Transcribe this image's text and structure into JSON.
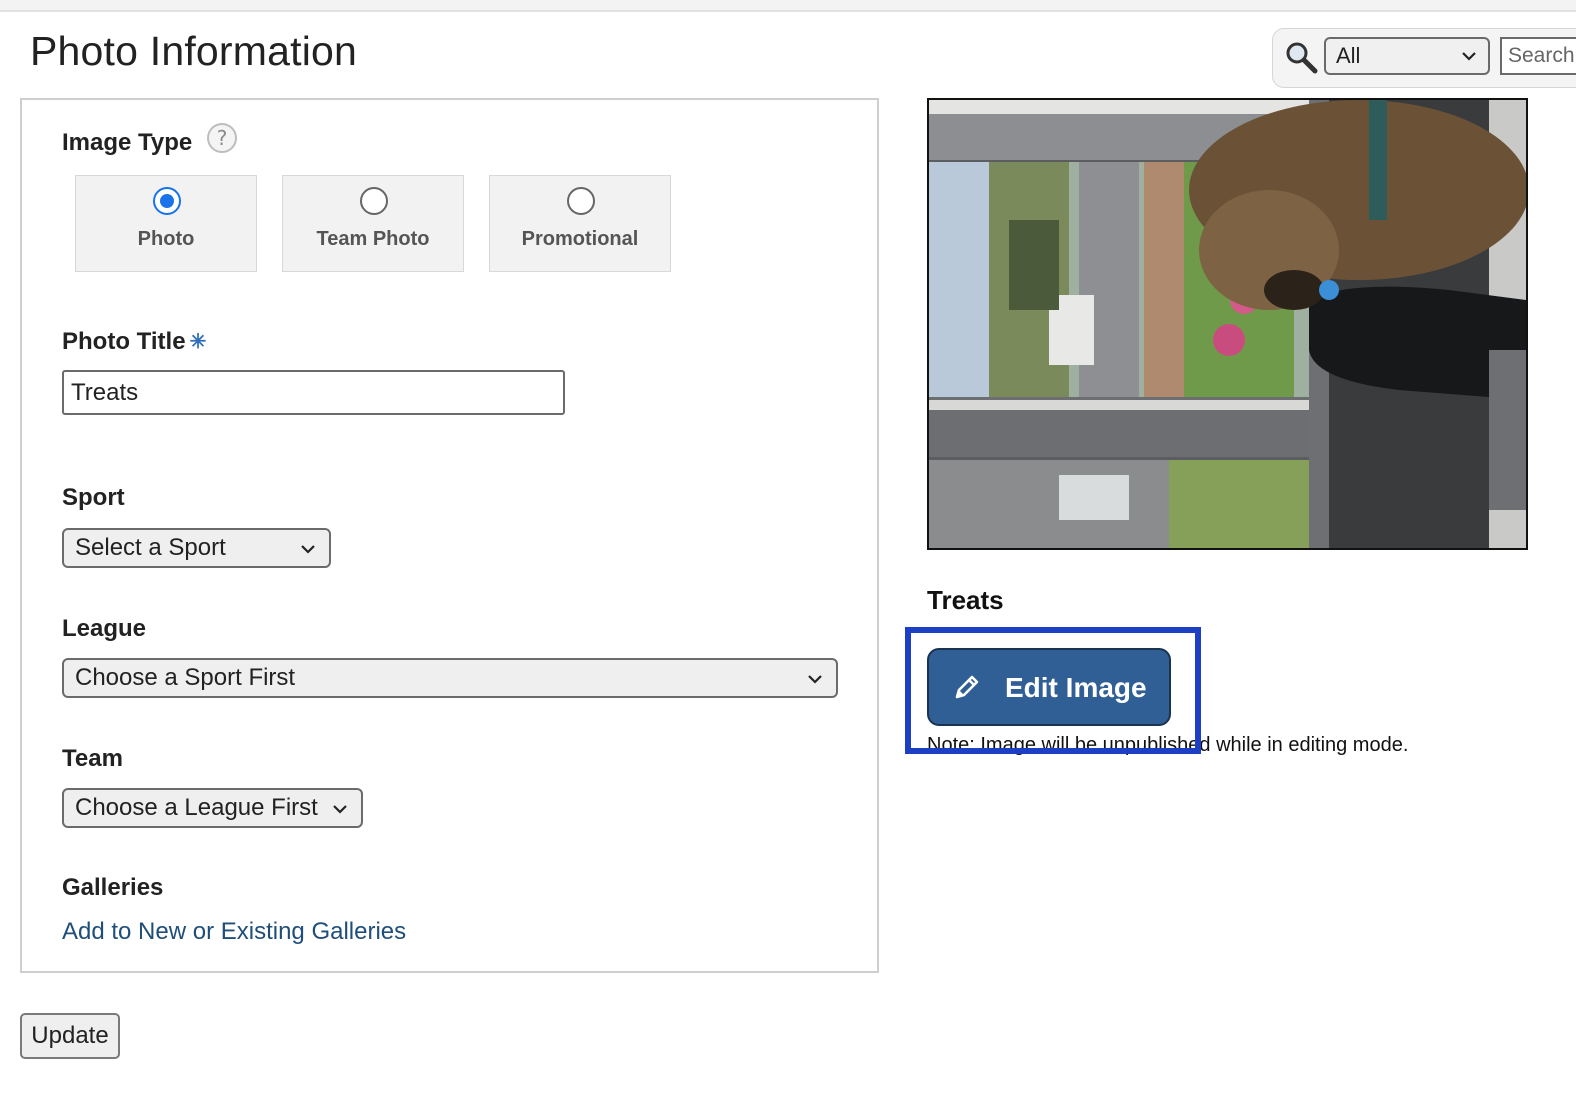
{
  "page": {
    "title": "Photo Information"
  },
  "search": {
    "scope_selected": "All",
    "placeholder": "Search"
  },
  "form": {
    "image_type": {
      "label": "Image Type",
      "options": [
        "Photo",
        "Team Photo",
        "Promotional"
      ],
      "selected": "Photo"
    },
    "photo_title": {
      "label": "Photo Title",
      "required_marker": "✳",
      "value": "Treats"
    },
    "sport": {
      "label": "Sport",
      "selected": "Select a Sport"
    },
    "league": {
      "label": "League",
      "selected": "Choose a Sport First"
    },
    "team": {
      "label": "Team",
      "selected": "Choose a League First"
    },
    "galleries": {
      "label": "Galleries",
      "link": "Add to New or Existing Galleries"
    },
    "update_label": "Update"
  },
  "preview": {
    "caption": "Treats",
    "edit_label": "Edit Image",
    "note": "Note: Image will be unpublished while in editing mode."
  },
  "icons": {
    "search": "search-icon",
    "help": "help-icon",
    "edit": "pencil-icon",
    "dropdown": "chevron-down-icon"
  },
  "colors": {
    "accent": "#1a73e8",
    "edit_button": "#2f5f95",
    "highlight": "#1d3fc4",
    "link": "#1f4e79"
  }
}
